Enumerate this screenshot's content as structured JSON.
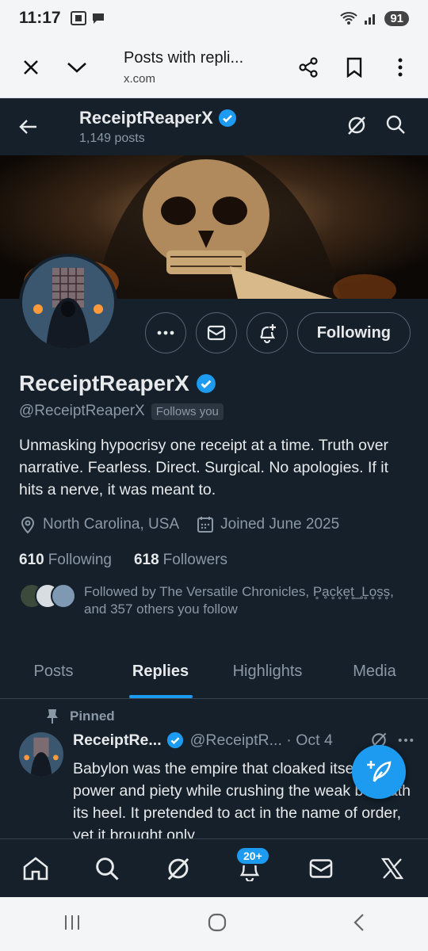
{
  "status": {
    "time": "11:17",
    "battery": "91"
  },
  "browser": {
    "title": "Posts with repli...",
    "url": "x.com"
  },
  "header": {
    "name": "ReceiptReaperX",
    "posts_count": "1,149 posts"
  },
  "profile": {
    "name": "ReceiptReaperX",
    "handle": "@ReceiptReaperX",
    "follows_you": "Follows you",
    "follow_button": "Following",
    "bio": "Unmasking hypocrisy one receipt at a time. Truth over narrative. Fearless. Direct. Surgical. No apologies. If it hits a nerve, it was meant to.",
    "location": "North Carolina, USA",
    "joined": "Joined June 2025",
    "following_count": "610",
    "following_label": "Following",
    "followers_count": "618",
    "followers_label": "Followers",
    "followed_by": "Followed by The Versatile Chronicles, P̥ḁc̥k̥e̥t̥_̥L̥o̥s̥s̥, and 357 others you follow"
  },
  "tabs": [
    "Posts",
    "Replies",
    "Highlights",
    "Media"
  ],
  "post": {
    "pinned_label": "Pinned",
    "author": "ReceiptRe...",
    "handle_date": "@ReceiptR... · Oct 4",
    "text": "Babylon was the empire that cloaked itself in power and piety while crushing the weak beneath its heel. It pretended to act in the name of order, yet it brought only"
  },
  "bottom_nav": {
    "notifications_badge": "20+"
  },
  "colors": {
    "background": "#15202b",
    "accent": "#1d9bf0",
    "muted": "#8b98a5"
  }
}
